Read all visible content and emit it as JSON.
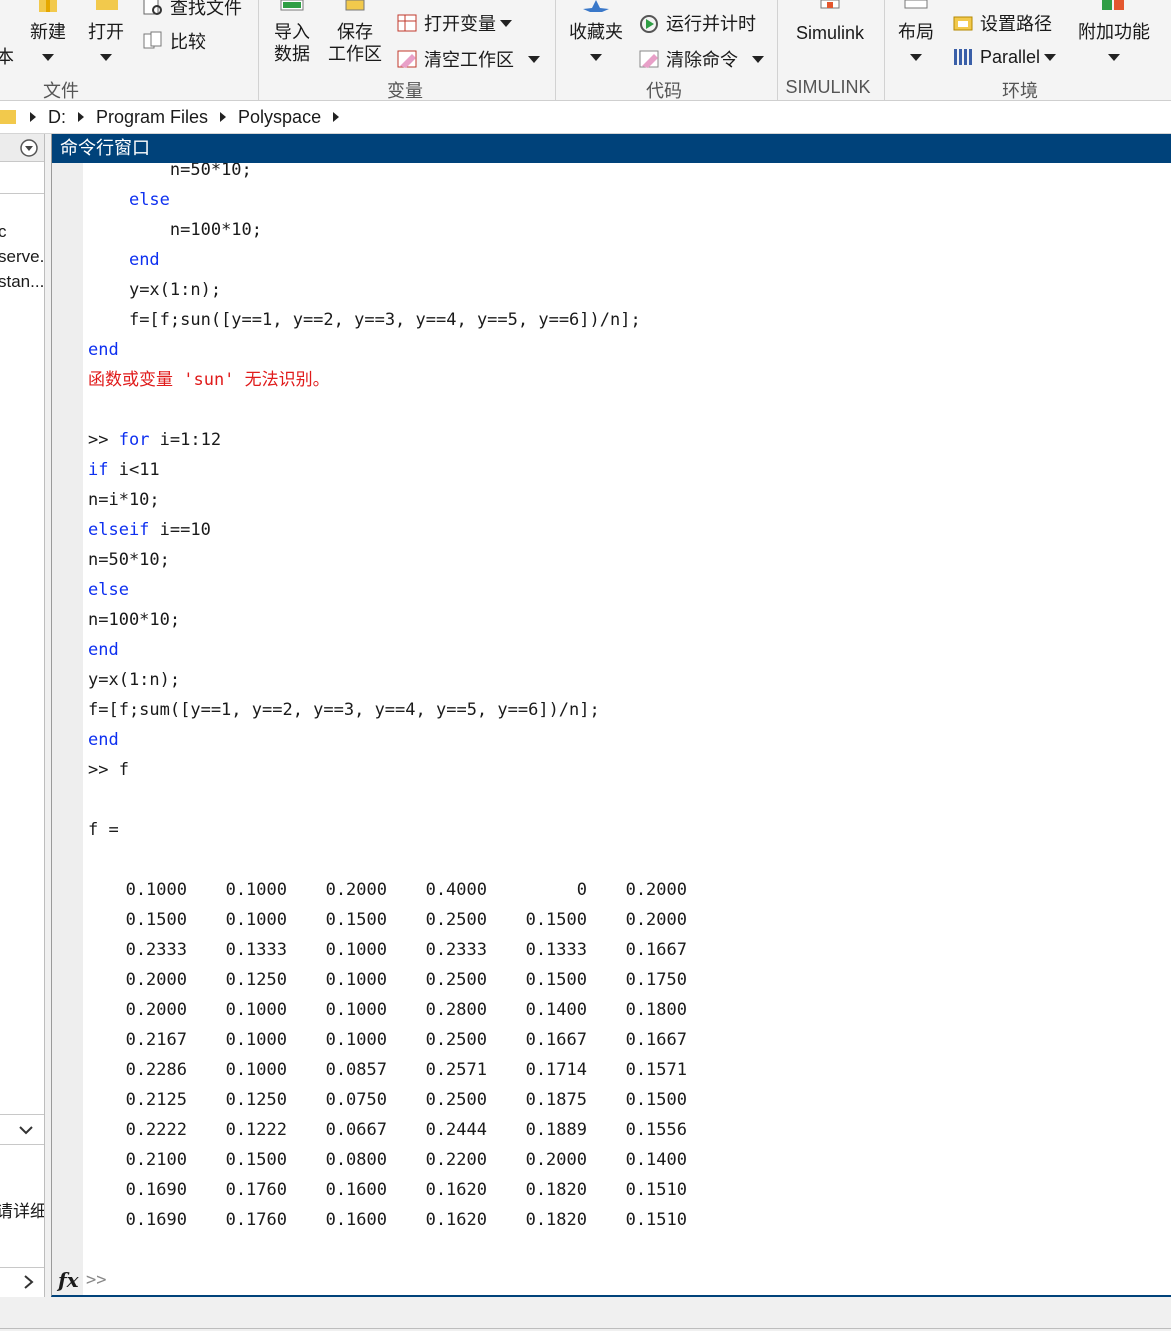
{
  "toolstrip": {
    "file": {
      "section_label": "文件",
      "new_label": "新建",
      "open_label": "打开",
      "find_files_label": "查找文件",
      "compare_label": "比较",
      "partial_left_label": "本"
    },
    "variable": {
      "section_label": "变量",
      "import_label_1": "导入",
      "import_label_2": "数据",
      "save_label_1": "保存",
      "save_label_2": "工作区",
      "open_var_label": "打开变量",
      "clear_ws_label": "清空工作区"
    },
    "code": {
      "section_label": "代码",
      "favorites_label": "收藏夹",
      "run_time_label": "运行并计时",
      "clear_cmd_label": "清除命令"
    },
    "simulink": {
      "section_label": "SIMULINK",
      "simulink_label": "Simulink"
    },
    "environment": {
      "section_label": "环境",
      "layout_label": "布局",
      "set_path_label": "设置路径",
      "parallel_label": "Parallel",
      "addons_label": "附加功能"
    }
  },
  "addressbar": {
    "crumbs": [
      "D:",
      "Program Files",
      "Polyspace"
    ]
  },
  "leftpanel": {
    "items": [
      "c",
      "serve...",
      "stan..."
    ],
    "details_label": "请详细信"
  },
  "command_window": {
    "title": "命令行窗口",
    "prompt": ">>",
    "lines": [
      {
        "indent": "        ",
        "text": "n=50*10;",
        "kind": "plain"
      },
      {
        "indent": "    ",
        "text": "else",
        "kind": "kw"
      },
      {
        "indent": "        ",
        "text": "n=100*10;",
        "kind": "plain"
      },
      {
        "indent": "    ",
        "text": "end",
        "kind": "kw"
      },
      {
        "indent": "    ",
        "text": "y=x(1:n);",
        "kind": "plain"
      },
      {
        "indent": "    ",
        "text": "f=[f;sun([y==1, y==2, y==3, y==4, y==5, y==6])/n];",
        "kind": "plain"
      },
      {
        "indent": "",
        "text": "end",
        "kind": "kw"
      },
      {
        "indent": "",
        "text": "函数或变量 'sun' 无法识别。",
        "kind": "err"
      },
      {
        "indent": "",
        "text": "",
        "kind": "plain"
      },
      {
        "indent": "",
        "prompt": ">> ",
        "kwtext": "for",
        "text": " i=1:12",
        "kind": "prompt-kw"
      },
      {
        "indent": "",
        "kwtext": "if",
        "text": " i<11",
        "kind": "kw-mixed"
      },
      {
        "indent": "",
        "text": "n=i*10;",
        "kind": "plain"
      },
      {
        "indent": "",
        "kwtext": "elseif",
        "text": " i==10",
        "kind": "kw-mixed"
      },
      {
        "indent": "",
        "text": "n=50*10;",
        "kind": "plain"
      },
      {
        "indent": "",
        "text": "else",
        "kind": "kw"
      },
      {
        "indent": "",
        "text": "n=100*10;",
        "kind": "plain"
      },
      {
        "indent": "",
        "text": "end",
        "kind": "kw"
      },
      {
        "indent": "",
        "text": "y=x(1:n);",
        "kind": "plain"
      },
      {
        "indent": "",
        "text": "f=[f;sum([y==1, y==2, y==3, y==4, y==5, y==6])/n];",
        "kind": "plain"
      },
      {
        "indent": "",
        "text": "end",
        "kind": "kw"
      },
      {
        "indent": "",
        "prompt": ">> ",
        "text": "f",
        "kind": "prompt-plain"
      },
      {
        "indent": "",
        "text": "",
        "kind": "plain"
      },
      {
        "indent": "",
        "text": "f =",
        "kind": "plain"
      },
      {
        "indent": "",
        "text": "",
        "kind": "plain"
      }
    ],
    "matrix": [
      [
        "0.1000",
        "0.1000",
        "0.2000",
        "0.4000",
        "0",
        "0.2000"
      ],
      [
        "0.1500",
        "0.1000",
        "0.1500",
        "0.2500",
        "0.1500",
        "0.2000"
      ],
      [
        "0.2333",
        "0.1333",
        "0.1000",
        "0.2333",
        "0.1333",
        "0.1667"
      ],
      [
        "0.2000",
        "0.1250",
        "0.1000",
        "0.2500",
        "0.1500",
        "0.1750"
      ],
      [
        "0.2000",
        "0.1000",
        "0.1000",
        "0.2800",
        "0.1400",
        "0.1800"
      ],
      [
        "0.2167",
        "0.1000",
        "0.1000",
        "0.2500",
        "0.1667",
        "0.1667"
      ],
      [
        "0.2286",
        "0.1000",
        "0.0857",
        "0.2571",
        "0.1714",
        "0.1571"
      ],
      [
        "0.2125",
        "0.1250",
        "0.0750",
        "0.2500",
        "0.1875",
        "0.1500"
      ],
      [
        "0.2222",
        "0.1222",
        "0.0667",
        "0.2444",
        "0.1889",
        "0.1556"
      ],
      [
        "0.2100",
        "0.1500",
        "0.0800",
        "0.2200",
        "0.2000",
        "0.1400"
      ],
      [
        "0.1690",
        "0.1760",
        "0.1600",
        "0.1620",
        "0.1820",
        "0.1510"
      ],
      [
        "0.1690",
        "0.1760",
        "0.1600",
        "0.1620",
        "0.1820",
        "0.1510"
      ]
    ]
  },
  "colors": {
    "title_bar": "#00427a",
    "keyword": "#0e30f0",
    "error": "#e01b1b"
  }
}
